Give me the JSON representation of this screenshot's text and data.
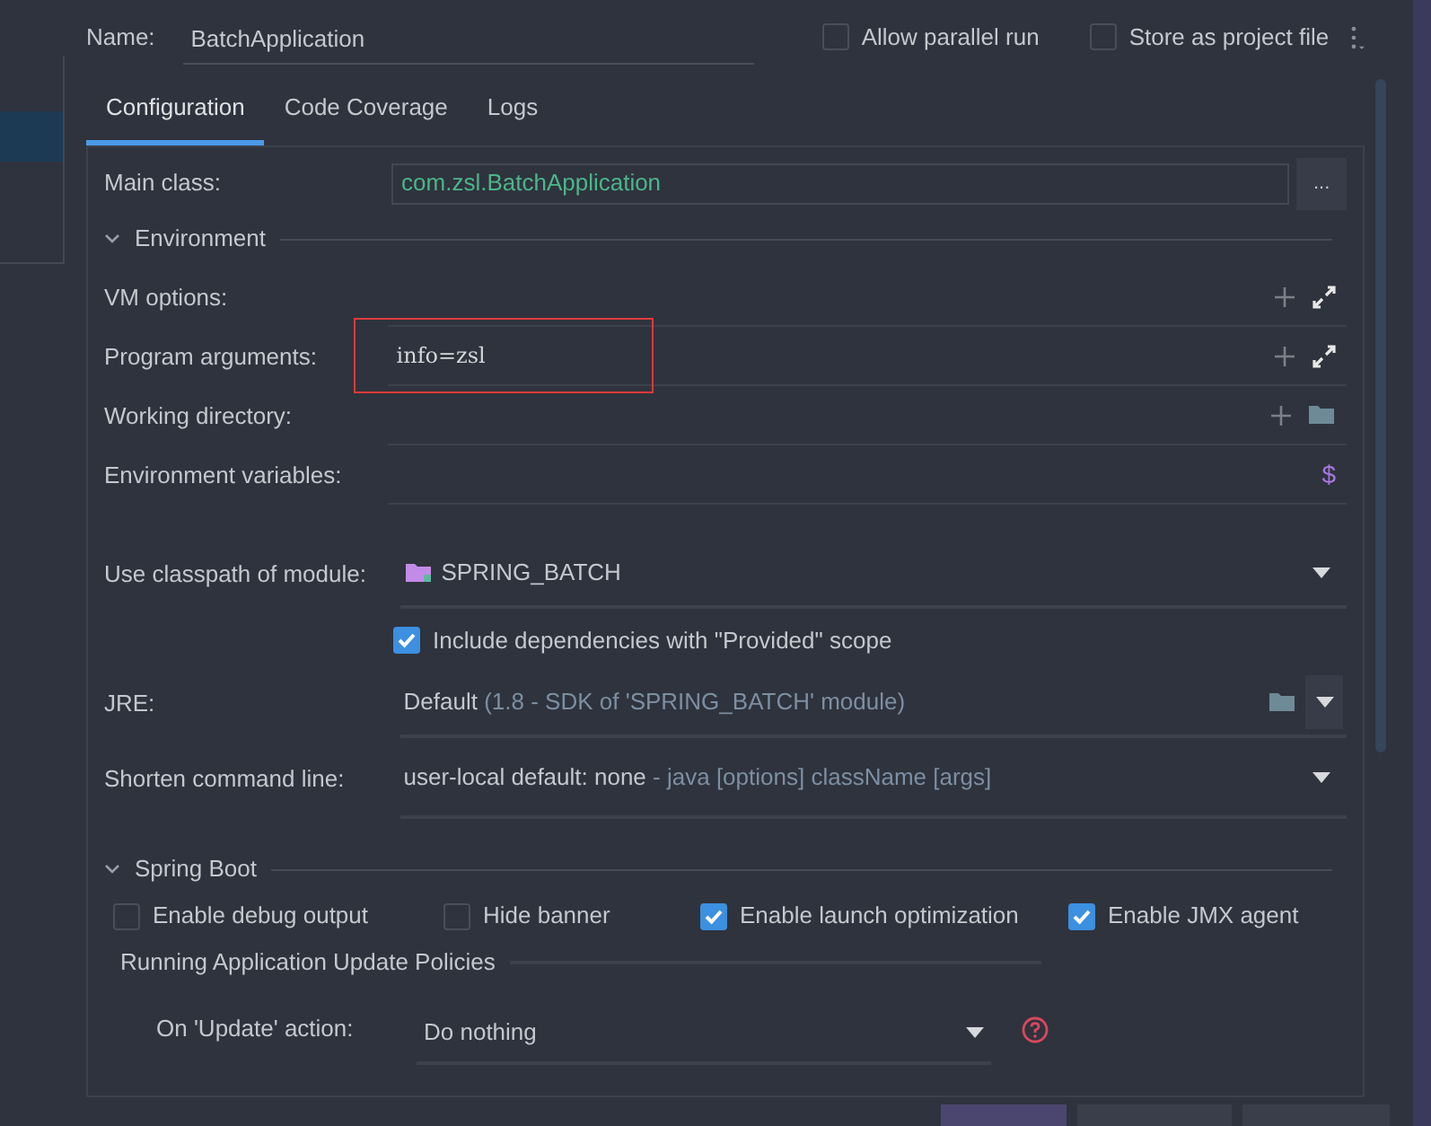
{
  "name_field": {
    "label": "Name:",
    "value": "BatchApplication"
  },
  "options": [
    {
      "label": "Allow parallel run",
      "checked": false
    },
    {
      "label": "Store as project file",
      "checked": false
    }
  ],
  "tabs": [
    {
      "label": "Configuration",
      "selected": true
    },
    {
      "label": "Code Coverage",
      "selected": false
    },
    {
      "label": "Logs",
      "selected": false
    }
  ],
  "main_class": {
    "label": "Main class:",
    "value": "com.zsl.BatchApplication",
    "button": "..."
  },
  "environment": {
    "title": "Environment",
    "expanded": true,
    "rows": [
      {
        "label": "VM options:",
        "value": "",
        "icons": [
          {
            "kind": "plus"
          },
          {
            "kind": "expand"
          }
        ],
        "highlighted": false
      },
      {
        "label": "Program arguments:",
        "value": "info=zsl",
        "icons": [
          {
            "kind": "plus"
          },
          {
            "kind": "expand"
          }
        ],
        "highlighted": true
      },
      {
        "label": "Working directory:",
        "value": "",
        "icons": [
          {
            "kind": "plus"
          },
          {
            "kind": "folder"
          }
        ],
        "highlighted": false
      },
      {
        "label": "Environment variables:",
        "value": "",
        "icons": [
          {
            "kind": "glyph",
            "glyph": "$"
          }
        ],
        "highlighted": false
      }
    ]
  },
  "classpath": {
    "label": "Use classpath of module:",
    "value": "SPRING_BATCH"
  },
  "include_dependencies": {
    "label": "Include dependencies with \"Provided\" scope",
    "checked": true
  },
  "jre": {
    "label": "JRE:",
    "value": "Default",
    "detail": "(1.8 - SDK of 'SPRING_BATCH' module)"
  },
  "shorten": {
    "label": "Shorten command line:",
    "value": "user-local default: none",
    "detail": "- java [options] className [args]"
  },
  "spring_boot": {
    "title": "Spring Boot",
    "expanded": true,
    "options": [
      {
        "label": "Enable debug output",
        "checked": false
      },
      {
        "label": "Hide banner",
        "checked": false
      },
      {
        "label": "Enable launch optimization",
        "checked": true
      },
      {
        "label": "Enable JMX agent",
        "checked": true
      }
    ],
    "policies_title": "Running Application Update Policies",
    "update_action": {
      "label": "On 'Update' action:",
      "value": "Do nothing"
    }
  }
}
